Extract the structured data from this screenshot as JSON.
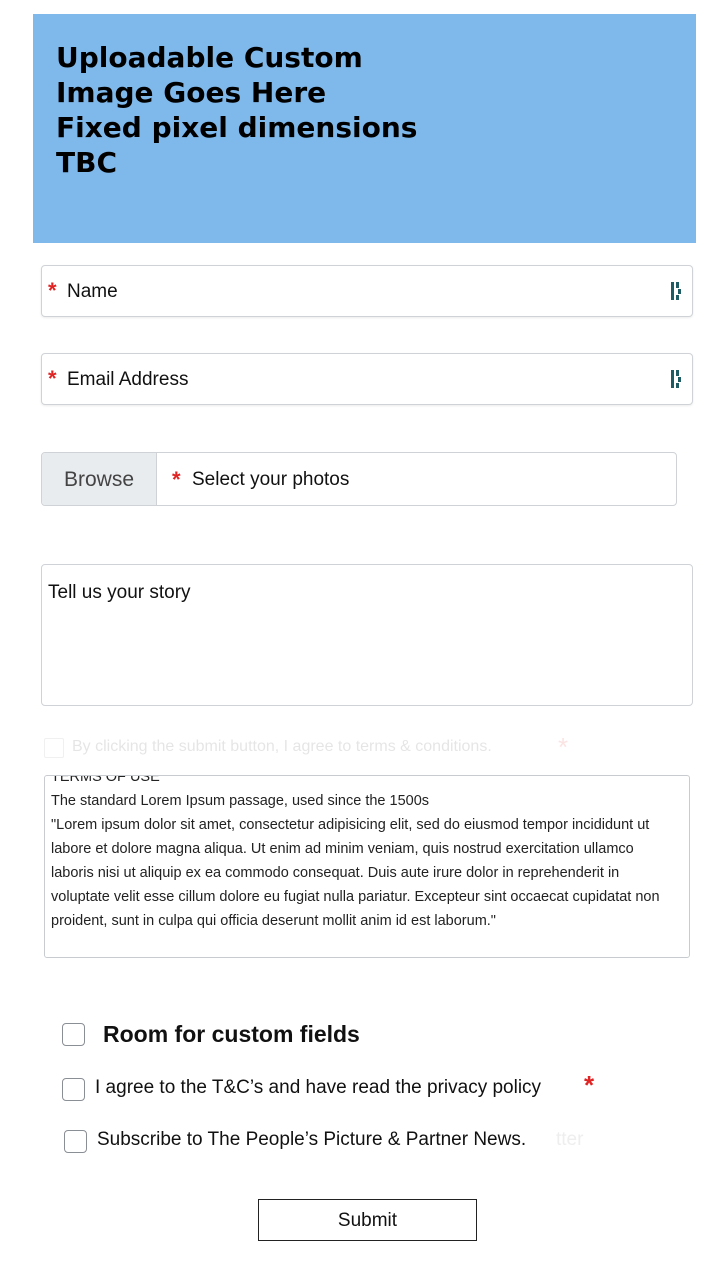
{
  "banner": {
    "text": "Uploadable Custom\nImage Goes Here\nFixed pixel dimensions\nTBC",
    "color": "#7fb9ec"
  },
  "form": {
    "name": {
      "required_mark": "*",
      "placeholder": "Name",
      "icon": "dashlane-icon"
    },
    "email": {
      "required_mark": "*",
      "placeholder": "Email Address",
      "icon": "dashlane-icon"
    },
    "photos": {
      "browse_label": "Browse",
      "required_mark": "*",
      "placeholder": "Select your photos"
    },
    "story": {
      "placeholder": "Tell us your story"
    },
    "faded_agree": {
      "text": "By clicking the submit button, I agree to terms & conditions.",
      "required_mark": "*"
    },
    "terms": {
      "heading": "TERMS OF USE",
      "subheading": "The standard Lorem Ipsum passage, used since the 1500s",
      "body": "\"Lorem ipsum dolor sit amet, consectetur adipisicing elit, sed do eiusmod tempor incididunt ut labore et dolore magna aliqua. Ut enim ad minim veniam, quis nostrud exercitation ullamco laboris nisi ut aliquip ex ea commodo consequat. Duis aute irure dolor in reprehenderit in voluptate velit esse cillum dolore eu fugiat nulla pariatur. Excepteur sint occaecat cupidatat non proident, sunt in culpa qui officia deserunt mollit anim id est laborum.\""
    },
    "checkboxes": {
      "custom_fields": {
        "label": "Room for custom fields",
        "checked": false
      },
      "agree": {
        "label": "I agree to the T&C’s and have read the privacy policy",
        "required_mark": "*",
        "checked": false
      },
      "subscribe": {
        "label": "Subscribe to The People’s Picture & Partner News.",
        "ghost_suffix": "tter",
        "checked": false
      }
    },
    "submit_label": "Submit"
  },
  "colors": {
    "required": "#e02424",
    "border": "#cfd3d7",
    "browse_bg": "#e9ecef"
  }
}
